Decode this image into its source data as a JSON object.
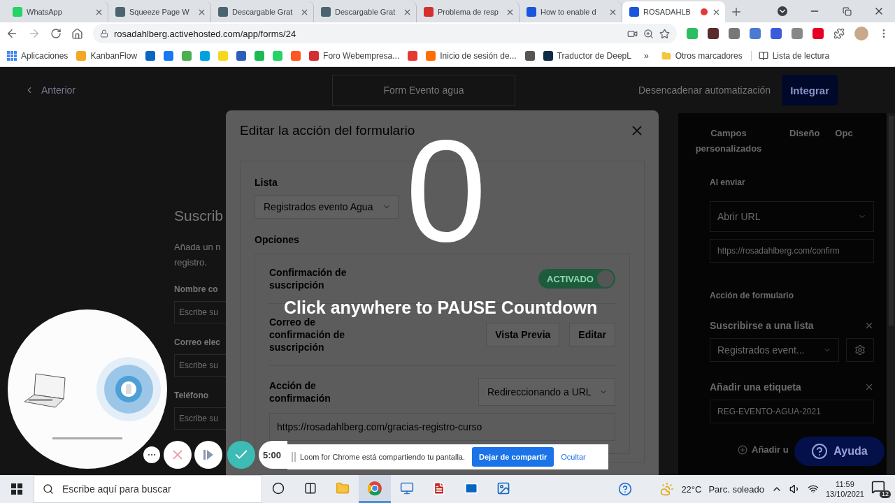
{
  "browser": {
    "tabs": [
      {
        "title": "WhatsApp",
        "selected": false,
        "recording": false,
        "color": "#25d366"
      },
      {
        "title": "Squeeze Page W",
        "selected": false,
        "recording": false,
        "color": "#4a6470"
      },
      {
        "title": "Descargable Grat",
        "selected": false,
        "recording": false,
        "color": "#4a6470"
      },
      {
        "title": "Descargable Grat",
        "selected": false,
        "recording": false,
        "color": "#4a6470"
      },
      {
        "title": "Problema de resp",
        "selected": false,
        "recording": false,
        "color": "#d32f2f"
      },
      {
        "title": "How to enable d",
        "selected": false,
        "recording": false,
        "color": "#1a56db"
      },
      {
        "title": "ROSADAHLB",
        "selected": true,
        "recording": true,
        "color": "#1a56db"
      }
    ],
    "address": "rosadahlberg.activehosted.com/app/forms/24",
    "extensions": [
      {
        "color": "#2dbe60"
      },
      {
        "color": "#5a2b2b"
      },
      {
        "color": "#777777"
      },
      {
        "color": "#4a7bd0"
      },
      {
        "color": "#3b5bdb"
      },
      {
        "color": "#888888"
      },
      {
        "color": "#e60023"
      }
    ],
    "bookmarks": [
      {
        "kind": "grid",
        "label": "Aplicaciones"
      },
      {
        "kind": "site",
        "label": "KanbanFlow",
        "color": "#f5a623"
      },
      {
        "kind": "site",
        "color": "#0a66c2"
      },
      {
        "kind": "site",
        "color": "#1877f2"
      },
      {
        "kind": "site",
        "color": "#4caf50"
      },
      {
        "kind": "site",
        "color": "#00a1e0"
      },
      {
        "kind": "site",
        "color": "#f8d81c"
      },
      {
        "kind": "site",
        "color": "#2e5fb8"
      },
      {
        "kind": "site",
        "color": "#1db954"
      },
      {
        "kind": "site",
        "color": "#25d366"
      },
      {
        "kind": "site",
        "color": "#ff5722"
      },
      {
        "kind": "site",
        "label": "Foro Webempresa...",
        "color": "#d32f2f"
      },
      {
        "kind": "site",
        "color": "#e53935"
      },
      {
        "kind": "site",
        "label": "Inicio de sesión de...",
        "color": "#ff6d00"
      },
      {
        "kind": "site",
        "color": "#555555"
      },
      {
        "kind": "site",
        "label": "Traductor de DeepL",
        "color": "#0f2b46"
      }
    ],
    "more": "»",
    "other_bookmarks": "Otros marcadores",
    "reading_list": "Lista de lectura"
  },
  "page": {
    "header": {
      "back": "Anterior",
      "form_name": "Form Evento agua",
      "trigger": "Desencadenar automatización",
      "integrate": "Integrar"
    },
    "form": {
      "title": "Suscrib",
      "description": [
        "Añada un n",
        "registro."
      ],
      "fields": [
        {
          "label": "Nombre co",
          "placeholder": "Escribe su"
        },
        {
          "label": "Correo elec",
          "placeholder": "Escribe su"
        },
        {
          "label": "Teléfono",
          "placeholder": "Escribe su"
        }
      ]
    },
    "panel": {
      "tabs": [
        "Campos personalizados",
        "Diseño",
        "Opc"
      ],
      "on_submit": "Al enviar",
      "submit_action": "Abrir URL",
      "url": "https://rosadahlberg.com/confirm",
      "form_action": "Acción de formulario",
      "actions": [
        {
          "kind": "select",
          "title": "Suscribirse a una lista",
          "value": "Registrados event..."
        },
        {
          "kind": "input",
          "title": "Añadir una etiqueta",
          "value": "REG-EVENTO-AGUA-2021"
        }
      ],
      "add": "Añadir u"
    },
    "help": "Ayuda"
  },
  "modal": {
    "title": "Editar la acción del formulario",
    "list_label": "Lista",
    "list_value": "Registrados evento Agua",
    "options_label": "Opciones",
    "options": [
      {
        "kind": "toggle",
        "label": "Confirmación de suscripción",
        "on": true,
        "toggle_label": "ACTIVADO"
      },
      {
        "kind": "buttons",
        "label": "Correo de confirmación de suscripción",
        "buttons": [
          "Vista Previa",
          "Editar"
        ]
      },
      {
        "kind": "select",
        "label": "Acción de confirmación",
        "value": "Redireccionando a URL",
        "url": "https://rosadahlberg.com/gracias-registro-curso"
      }
    ]
  },
  "countdown": {
    "number": "0",
    "message": "Click anywhere to PAUSE Countdown"
  },
  "loom": {
    "timer": "5:00",
    "share_message": "Loom for Chrome está compartiendo tu pantalla.",
    "stop": "Dejar de compartir",
    "hide": "Ocultar"
  },
  "taskbar": {
    "search_placeholder": "Escribe aquí para buscar",
    "apps": [
      {
        "kind": "cortana",
        "selected": false
      },
      {
        "kind": "taskview",
        "selected": false
      },
      {
        "kind": "folder",
        "selected": false
      },
      {
        "kind": "browser",
        "selected": true
      },
      {
        "kind": "computer",
        "selected": false
      },
      {
        "kind": "pdf",
        "selected": false
      },
      {
        "kind": "mail",
        "selected": false
      },
      {
        "kind": "photos",
        "selected": false
      }
    ],
    "temperature": "22°C",
    "weather": "Parc. soleado",
    "time": "11:59",
    "date": "13/10/2021",
    "notifications": "12"
  }
}
